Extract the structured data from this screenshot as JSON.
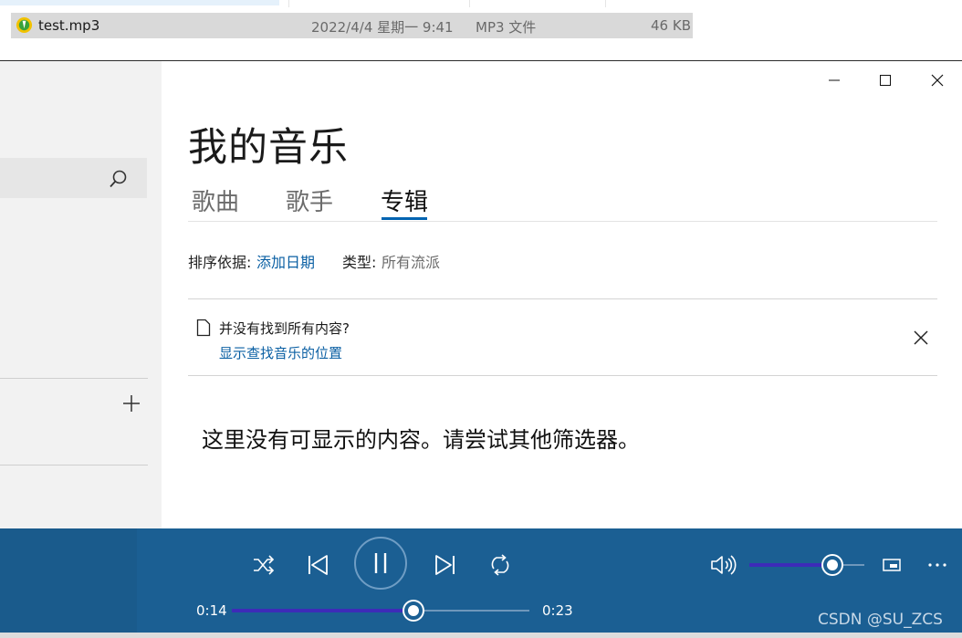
{
  "explorer": {
    "file_name": "test.mp3",
    "file_date": "2022/4/4 星期一 9:41",
    "file_type": "MP3 文件",
    "file_size": "46 KB"
  },
  "app": {
    "title": "我的音乐",
    "tabs": [
      {
        "label": "歌曲",
        "active": false
      },
      {
        "label": "歌手",
        "active": false
      },
      {
        "label": "专辑",
        "active": true
      }
    ],
    "sort_label": "排序依据:",
    "sort_value": "添加日期",
    "type_label": "类型:",
    "type_value": "所有流派",
    "notice_text": "并没有找到所有内容?",
    "notice_link": "显示查找音乐的位置",
    "empty_message": "这里没有可显示的内容。请尝试其他筛选器。"
  },
  "player": {
    "current_time": "0:14",
    "total_time": "0:23",
    "progress": 0.61,
    "volume": 0.72
  },
  "watermark": "CSDN @SU_ZCS",
  "colors": {
    "accent": "#0063b1",
    "player_bg": "#1b5f93",
    "slider_fill": "#3d2bb8",
    "link": "#0a5fa3"
  },
  "icons": [
    "search-icon",
    "add-icon",
    "minimize-icon",
    "maximize-icon",
    "close-icon",
    "document-icon",
    "shuffle-icon",
    "previous-icon",
    "pause-icon",
    "next-icon",
    "repeat-icon",
    "volume-icon",
    "mini-player-icon",
    "more-icon",
    "mp3-file-icon"
  ]
}
